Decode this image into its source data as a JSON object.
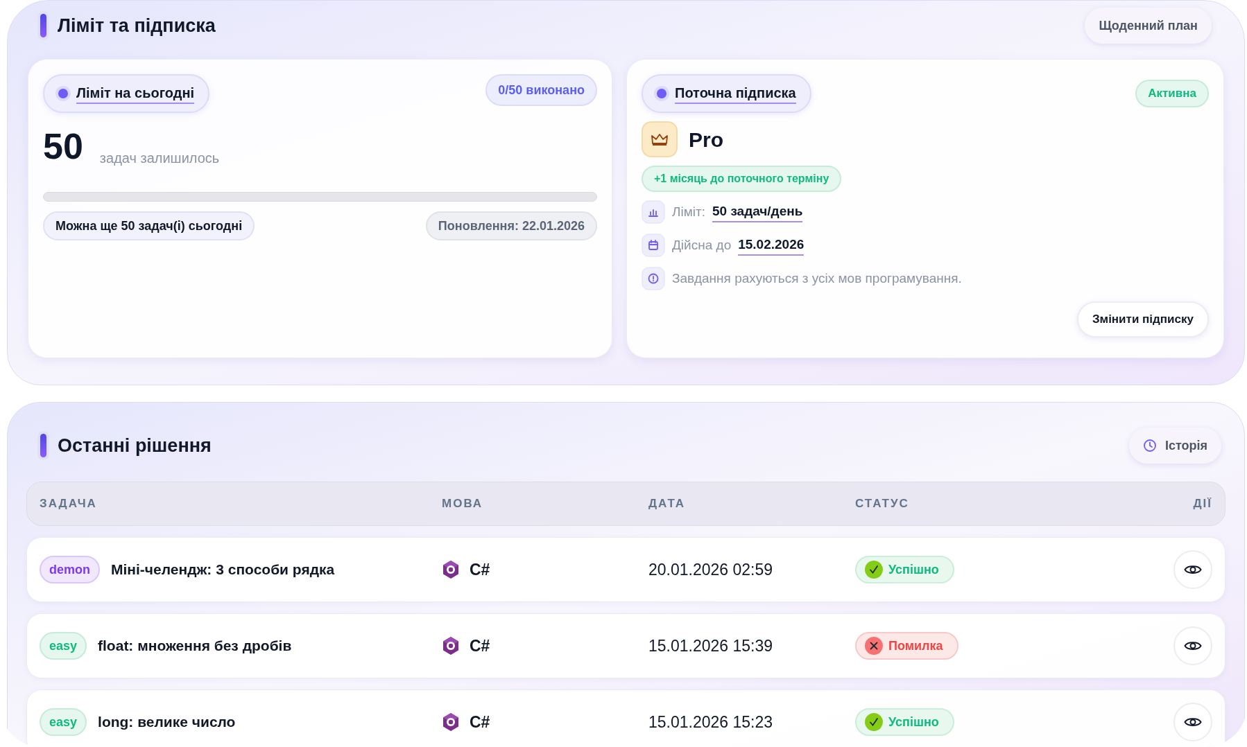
{
  "limit_section": {
    "title": "Ліміт та підписка",
    "plan_button": "Щоденний план",
    "today_card": {
      "heading": "Ліміт на сьогодні",
      "done_badge": "0/50 виконано",
      "remaining": "50",
      "remaining_label": "задач залишилось",
      "progress": {
        "level": 0
      },
      "can_more": "Можна ще 50 задач(і) сьогодні",
      "renewal": "Поновлення: 22.01.2026"
    },
    "subscription_card": {
      "heading": "Поточна підписка",
      "status_badge": "Активна",
      "plan_name": "Pro",
      "bonus_badge": "+1 місяць до поточного терміну",
      "details": [
        {
          "kind": "limit",
          "label": "Ліміт:",
          "value": "50 задач/день"
        },
        {
          "kind": "valid",
          "label": "Дійсна до",
          "value": "15.02.2026"
        },
        {
          "kind": "note",
          "label": "Завдання рахуються з усіх мов програмування."
        }
      ],
      "change_button": "Змінити підписку"
    }
  },
  "solutions_section": {
    "title": "Останні рішення",
    "history_button": "Історія",
    "table": {
      "columns": [
        "ЗАДАЧА",
        "МОВА",
        "ДАТА",
        "СТАТУС",
        "ДІЇ"
      ],
      "rows": [
        {
          "difficulty": {
            "kind": "demon",
            "label": "demon"
          },
          "task": "Міні-челендж: 3 способи рядка",
          "language": "C#",
          "date": "20.01.2026 02:59",
          "status": {
            "kind": "success",
            "label": "Успішно"
          }
        },
        {
          "difficulty": {
            "kind": "easy",
            "label": "easy"
          },
          "task": "float: множення без дробів",
          "language": "C#",
          "date": "15.01.2026 15:39",
          "status": {
            "kind": "error",
            "label": "Помилка"
          }
        },
        {
          "difficulty": {
            "kind": "easy",
            "label": "easy"
          },
          "task": "long: велике число",
          "language": "C#",
          "date": "15.01.2026 15:23",
          "status": {
            "kind": "success",
            "label": "Успішно"
          }
        }
      ]
    }
  }
}
